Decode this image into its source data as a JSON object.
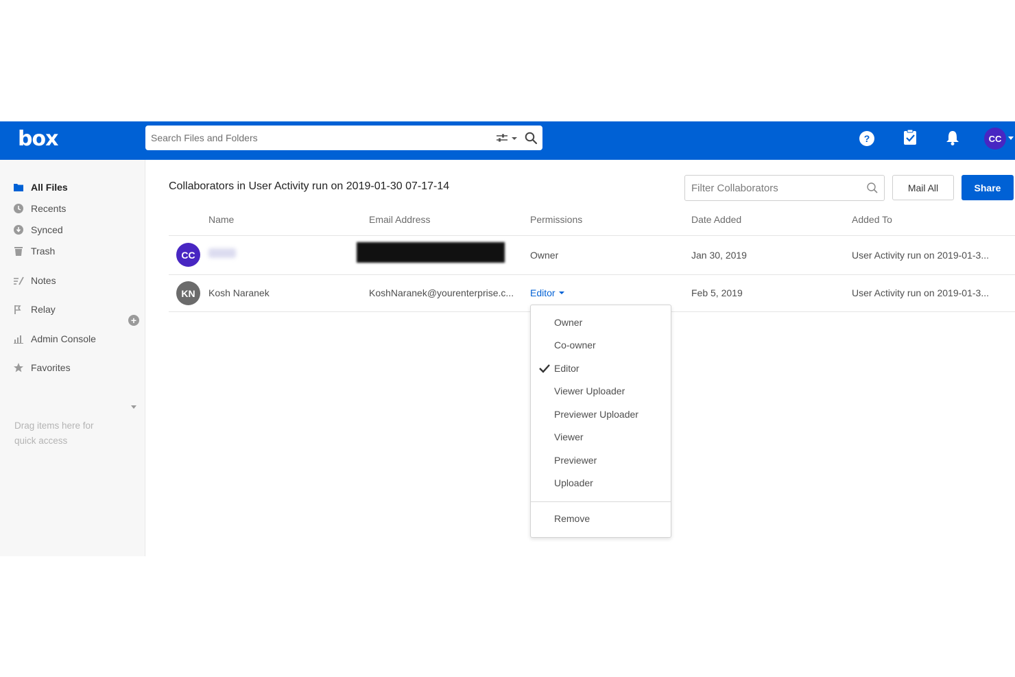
{
  "app": {
    "logo": "box"
  },
  "header": {
    "search_placeholder": "Search Files and Folders",
    "icons": [
      "search-options-icon",
      "search-icon",
      "help-icon",
      "tasks-icon",
      "notifications-icon"
    ],
    "user_initials": "CC",
    "brand_color": "#0061d5"
  },
  "sidebar": {
    "items": [
      {
        "label": "All Files",
        "icon": "folder-icon",
        "active": true
      },
      {
        "label": "Recents",
        "icon": "clock-icon"
      },
      {
        "label": "Synced",
        "icon": "sync-icon"
      },
      {
        "label": "Trash",
        "icon": "trash-icon"
      },
      {
        "label": "Notes",
        "icon": "notes-icon"
      },
      {
        "label": "Relay",
        "icon": "relay-icon"
      },
      {
        "label": "Admin Console",
        "icon": "chart-icon"
      },
      {
        "label": "Favorites",
        "icon": "star-icon"
      }
    ],
    "favorites_hint": "Drag items here for quick access"
  },
  "main": {
    "title": "Collaborators in User Activity run on 2019-01-30 07-17-14",
    "filter_placeholder": "Filter Collaborators",
    "mail_all_label": "Mail All",
    "share_label": "Share",
    "columns": [
      "Name",
      "Email Address",
      "Permissions",
      "Date Added",
      "Added To"
    ],
    "rows": [
      {
        "initials": "CC",
        "avatar_color": "#4826c2",
        "name": "",
        "email": "",
        "permission": "Owner",
        "date_added": "Jan 30, 2019",
        "added_to": "User Activity run on 2019-01-3..."
      },
      {
        "initials": "KN",
        "avatar_color": "#6b6b6b",
        "name": "Kosh Naranek",
        "email": "KoshNaranek@yourenterprise.c...",
        "permission": "Editor",
        "date_added": "Feb 5, 2019",
        "added_to": "User Activity run on 2019-01-3..."
      }
    ]
  },
  "permission_menu": {
    "options": [
      "Owner",
      "Co-owner",
      "Editor",
      "Viewer Uploader",
      "Previewer Uploader",
      "Viewer",
      "Previewer",
      "Uploader"
    ],
    "selected": "Editor",
    "remove_label": "Remove"
  }
}
